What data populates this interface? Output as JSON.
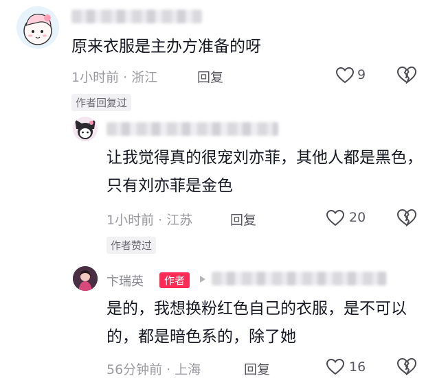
{
  "comments": [
    {
      "text": "原来衣服是主办方准备的呀",
      "meta": "1小时前 · 浙江",
      "reply_label": "回复",
      "likes": "9",
      "badge": "作者回复过"
    },
    {
      "text": "让我觉得真的很宠刘亦菲，其他人都是黑色，只有刘亦菲是金色",
      "meta": "1小时前 · 江苏",
      "reply_label": "回复",
      "likes": "20",
      "badge": "作者赞过"
    },
    {
      "username": "卞瑞英",
      "author_tag": "作者",
      "text": "是的，我想换粉红色自己的衣服，是不可以的，都是暗色系的，除了她",
      "meta": "56分钟前 · 上海",
      "reply_label": "回复",
      "likes": "16"
    }
  ],
  "icons": {
    "like": "heart-outline-icon",
    "dislike": "broken-heart-outline-icon",
    "reply_arrow": "play-triangle-icon"
  },
  "colors": {
    "author_tag_bg": "#fe2c55",
    "secondary_text": "#9a9aa0"
  }
}
